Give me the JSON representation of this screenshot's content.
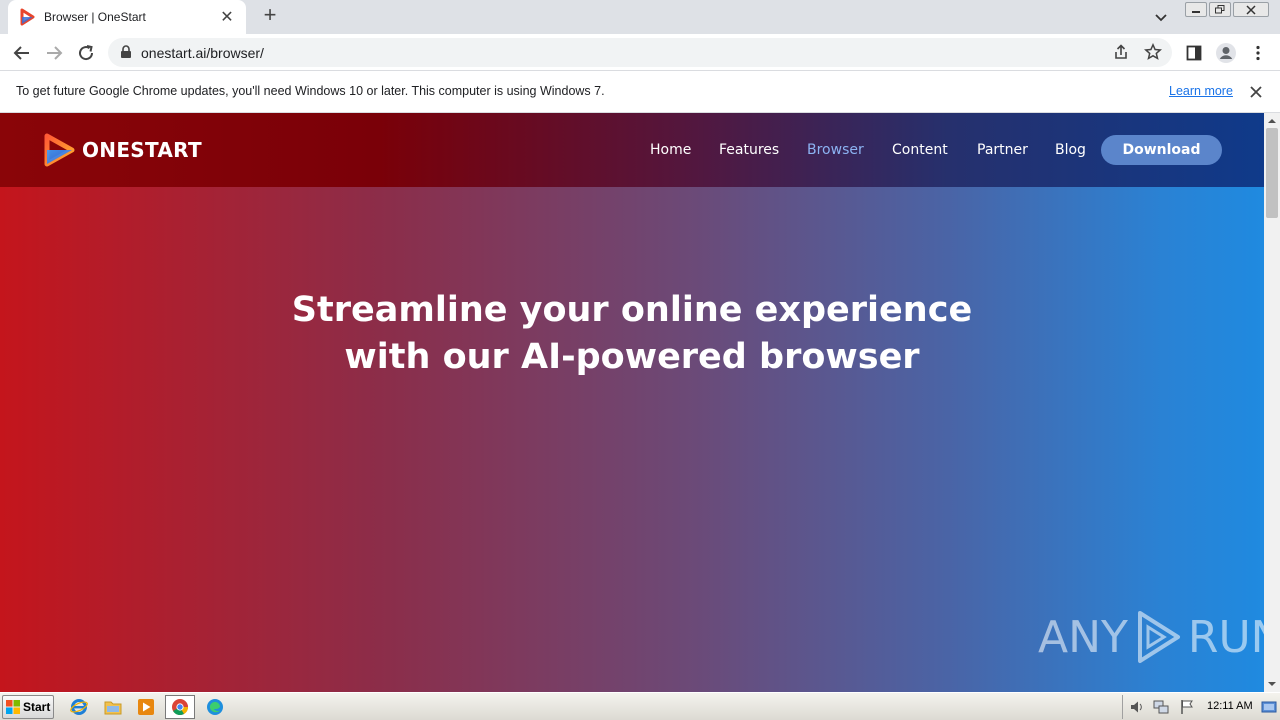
{
  "browser": {
    "tab_title": "Browser | OneStart",
    "tab_close": "✕",
    "new_tab": "+",
    "url": "onestart.ai/browser/"
  },
  "infobar": {
    "message": "To get future Google Chrome updates, you'll need Windows 10 or later. This computer is using Windows 7.",
    "learn_more": "Learn more"
  },
  "site": {
    "logo_text": "ONESTART",
    "nav": [
      "Home",
      "Features",
      "Browser",
      "Content",
      "Partner",
      "Blog"
    ],
    "active_nav": "Browser",
    "download_label": "Download",
    "hero_line1": "Streamline your online experience",
    "hero_line2": "with our AI-powered browser",
    "accent_color": "#5b85cb"
  },
  "watermark": {
    "left": "ANY",
    "right": "RUN"
  },
  "taskbar": {
    "start_label": "Start",
    "clock": "12:11 AM",
    "icons": [
      "internet-explorer-icon",
      "file-explorer-icon",
      "media-player-icon",
      "chrome-icon",
      "edge-icon"
    ]
  }
}
